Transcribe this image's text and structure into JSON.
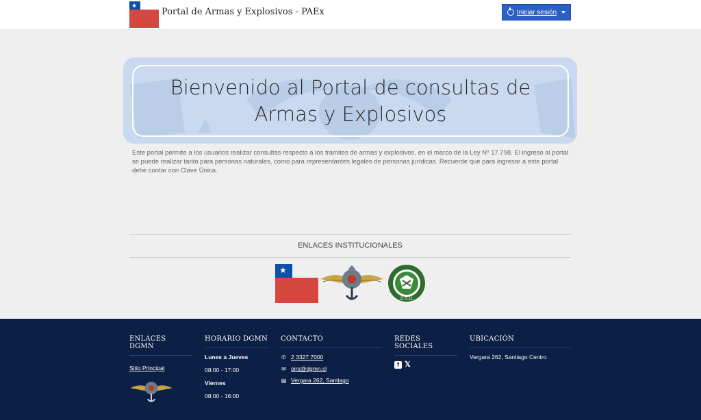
{
  "header": {
    "brand": "Portal de Armas y Explosivos - PAEx",
    "logo_text": "Gobierno de Chile",
    "login_label": "Iniciar sesión"
  },
  "banner": {
    "title": "Bienvenido al Portal de consultas de Armas y Explosivos"
  },
  "intro": "Este portal permite a los usuarios realizar consultas respecto a los trámites de armas y explosivos, en el marco de la Ley Nº 17.798. El ingreso al portal se puede realizar tanto para personas naturales, como para representantes legales de personas jurídicas. Recuerde que para ingresar a este portal debe contar con Clave Única.",
  "institutional": {
    "heading": "ENLACES INSTITUCIONALES",
    "ministry_text": "Ministerio de Defensa Nacional",
    "ministry_sub": "Gobierno de Chile",
    "od11_text": "O.S.11"
  },
  "footer": {
    "links": {
      "heading": "ENLACES DGMN",
      "main_site": "Sitio Principal"
    },
    "schedule": {
      "heading": "HORARIO DGMN",
      "day1": "Lunes a Jueves",
      "hours1": "08:00 - 17:00",
      "day2": "Viernes",
      "hours2": "08:00 - 16:00"
    },
    "contact": {
      "heading": "CONTACTO",
      "phone": "2 3327 7000",
      "email": "oirs@dgmn.cl",
      "address": "Vergara 262, Santiago"
    },
    "social": {
      "heading": "REDES SOCIALES",
      "icons": [
        "facebook-icon",
        "x-icon"
      ]
    },
    "location": {
      "heading": "UBICACIÓN",
      "address": "Vergara 262, Santiago Centro"
    }
  },
  "colors": {
    "primary": "#2c5fc4",
    "footer_bg": "#0c1f45",
    "gov_blue": "#0f4fa8",
    "gov_red": "#d5473f",
    "banner_bg": "#c9daf0"
  }
}
